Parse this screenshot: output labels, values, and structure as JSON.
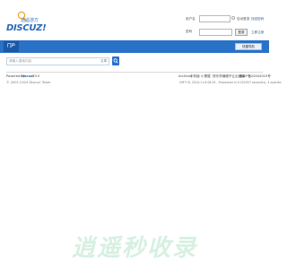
{
  "logo": {
    "text": "DISCUZ!",
    "subtitle": "逍遥游方"
  },
  "login": {
    "username_label": "用户名",
    "password_label": "密码",
    "remember_label": "自动登录",
    "forgot_link": "找回密码",
    "register_link": "立即注册",
    "login_button": "登录"
  },
  "nav": {
    "tabs": [
      {
        "label": "门户"
      }
    ],
    "quick_nav_label": "快捷导航"
  },
  "search": {
    "placeholder": "请输入搜索内容",
    "type_label": "文章"
  },
  "footer": {
    "powered_by_prefix": "Powered by",
    "powered_by_name": "Discuz!",
    "version": "X3.5",
    "copyright": "© 2001-2024 Discuz! Team.",
    "links": [
      "Archiver",
      "手机版",
      "小黑屋",
      "快乐学编程不让出错编",
      "赣ICP备20042010号"
    ],
    "stats": "GMT+8, 2024-11-6 08:25 , Processed in 0.022057 second(s), 4 queries ."
  },
  "watermark": "逍遥秒收录",
  "colors": {
    "nav_bg": "#2a71c8",
    "nav_active": "#1b59a6",
    "logo": "#2a68b8"
  }
}
